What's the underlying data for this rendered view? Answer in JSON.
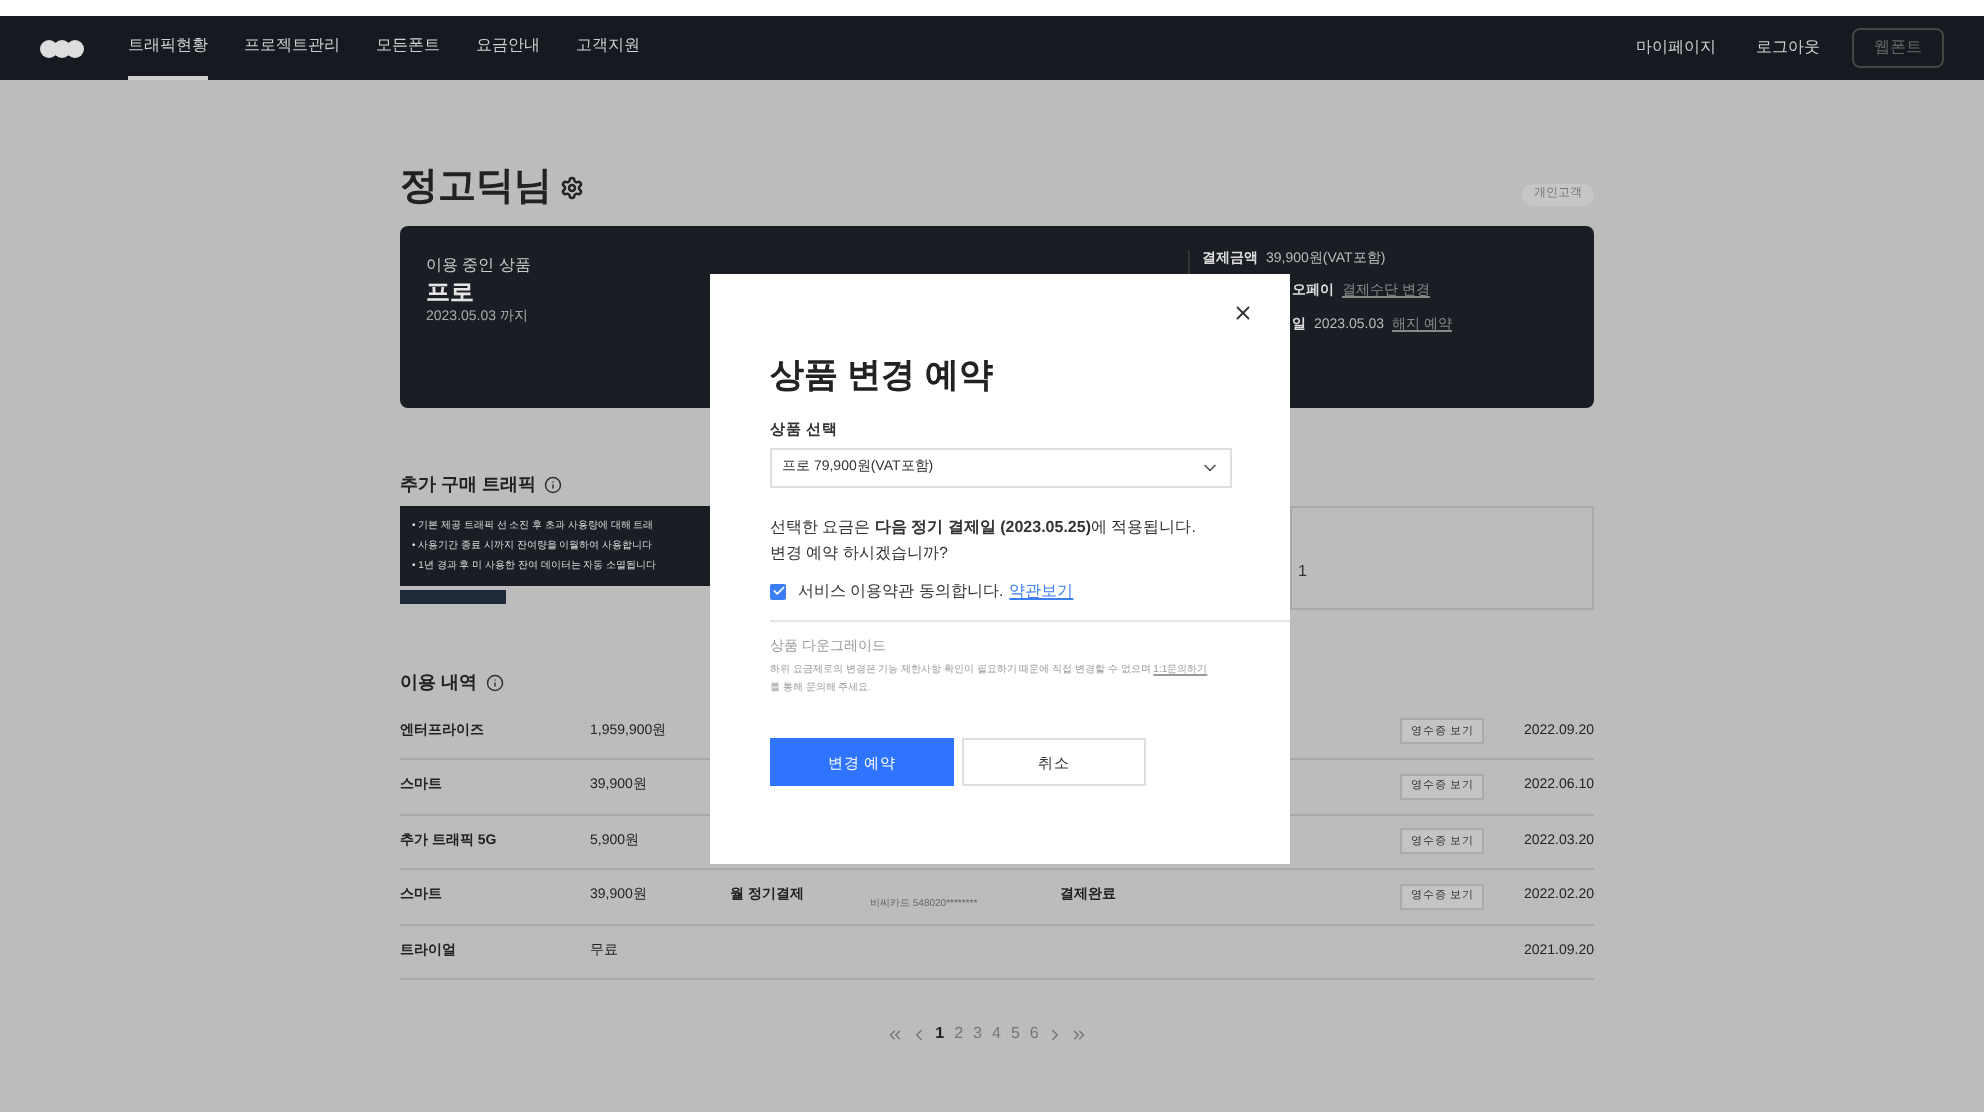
{
  "nav": {
    "items": [
      {
        "label": "트래픽현황",
        "selected": true
      },
      {
        "label": "프로젝트관리",
        "selected": false
      },
      {
        "label": "모든폰트",
        "selected": false
      },
      {
        "label": "요금안내",
        "selected": false
      },
      {
        "label": "고객지원",
        "selected": false
      }
    ],
    "links": [
      "마이페이지",
      "로그아웃"
    ],
    "button": {
      "label": "웹폰트",
      "disabled": true
    }
  },
  "profile": {
    "name": "정고딕님",
    "badge": "개인고객"
  },
  "plan_card": {
    "caption": "이용 중인 상품",
    "plan": "프로",
    "until": "2023.05.03 까지",
    "details": [
      {
        "label": "결제금액",
        "value": "39,900원(VAT포함)"
      },
      {
        "label": "오페이",
        "link": "결제수단 변경"
      },
      {
        "label": "일",
        "value": "2023.05.03",
        "link": "해지 예약"
      }
    ]
  },
  "traffic": {
    "title": "추가 구매 트래픽",
    "tooltip": [
      "• 기본 제공 트래픽 선 소진 후 초과 사용량에 대해 트래",
      "• 사용기간 종료 시까지 잔여량을 이월하여 사용합니다",
      "• 1년 경과 후 미 사용한 잔여 데이터는 자동 소멸됩니다"
    ],
    "box_value": "1"
  },
  "history": {
    "title": "이용 내역",
    "rows": [
      {
        "product": "엔터프라이즈",
        "amount": "1,959,900원",
        "receipt": "영수증 보기",
        "date": "2022.09.20"
      },
      {
        "product": "스마트",
        "amount": "39,900원",
        "receipt": "영수증 보기",
        "date": "2022.06.10"
      },
      {
        "product": "추가 트래픽 5G",
        "amount": "5,900원",
        "receipt": "영수증 보기",
        "date": "2022.03.20"
      },
      {
        "product": "스마트",
        "amount": "39,900원",
        "method": "월 정기결제",
        "card": "비씨카드 548020********",
        "status": "결제완료",
        "receipt": "영수증 보기",
        "date": "2022.02.20"
      },
      {
        "product": "트라이얼",
        "amount": "무료",
        "date": "2021.09.20"
      }
    ]
  },
  "pagination": {
    "pages": [
      {
        "label": "1",
        "selected": true
      },
      {
        "label": "2",
        "selected": false
      },
      {
        "label": "3",
        "selected": false
      },
      {
        "label": "4",
        "selected": false
      },
      {
        "label": "5",
        "selected": false
      },
      {
        "label": "6",
        "selected": false
      }
    ]
  },
  "modal": {
    "title": "상품 변경 예약",
    "select_label": "상품 선택",
    "select_value": "프로 79,900원(VAT포함)",
    "message": "선택한 요금은 **다음 정기 결제일 (2023.05.25)**에 적용됩니다.",
    "question": "변경 예약 하시겠습니까?",
    "agree": {
      "label": "서비스 이용약관 동의합니다.",
      "link": "약관보기",
      "checked": true
    },
    "downgrade_title": "상품 다운그레이드",
    "downgrade_text": "하위 요금제로의 변경은 기능 제한사항 확인이 필요하기 때문에 직접 변경할 수 없으며",
    "downgrade_link": "1:1문의하기",
    "downgrade_tail": "를 통해 문의해 주세요.",
    "confirm": "변경 예약",
    "cancel": "취소"
  }
}
